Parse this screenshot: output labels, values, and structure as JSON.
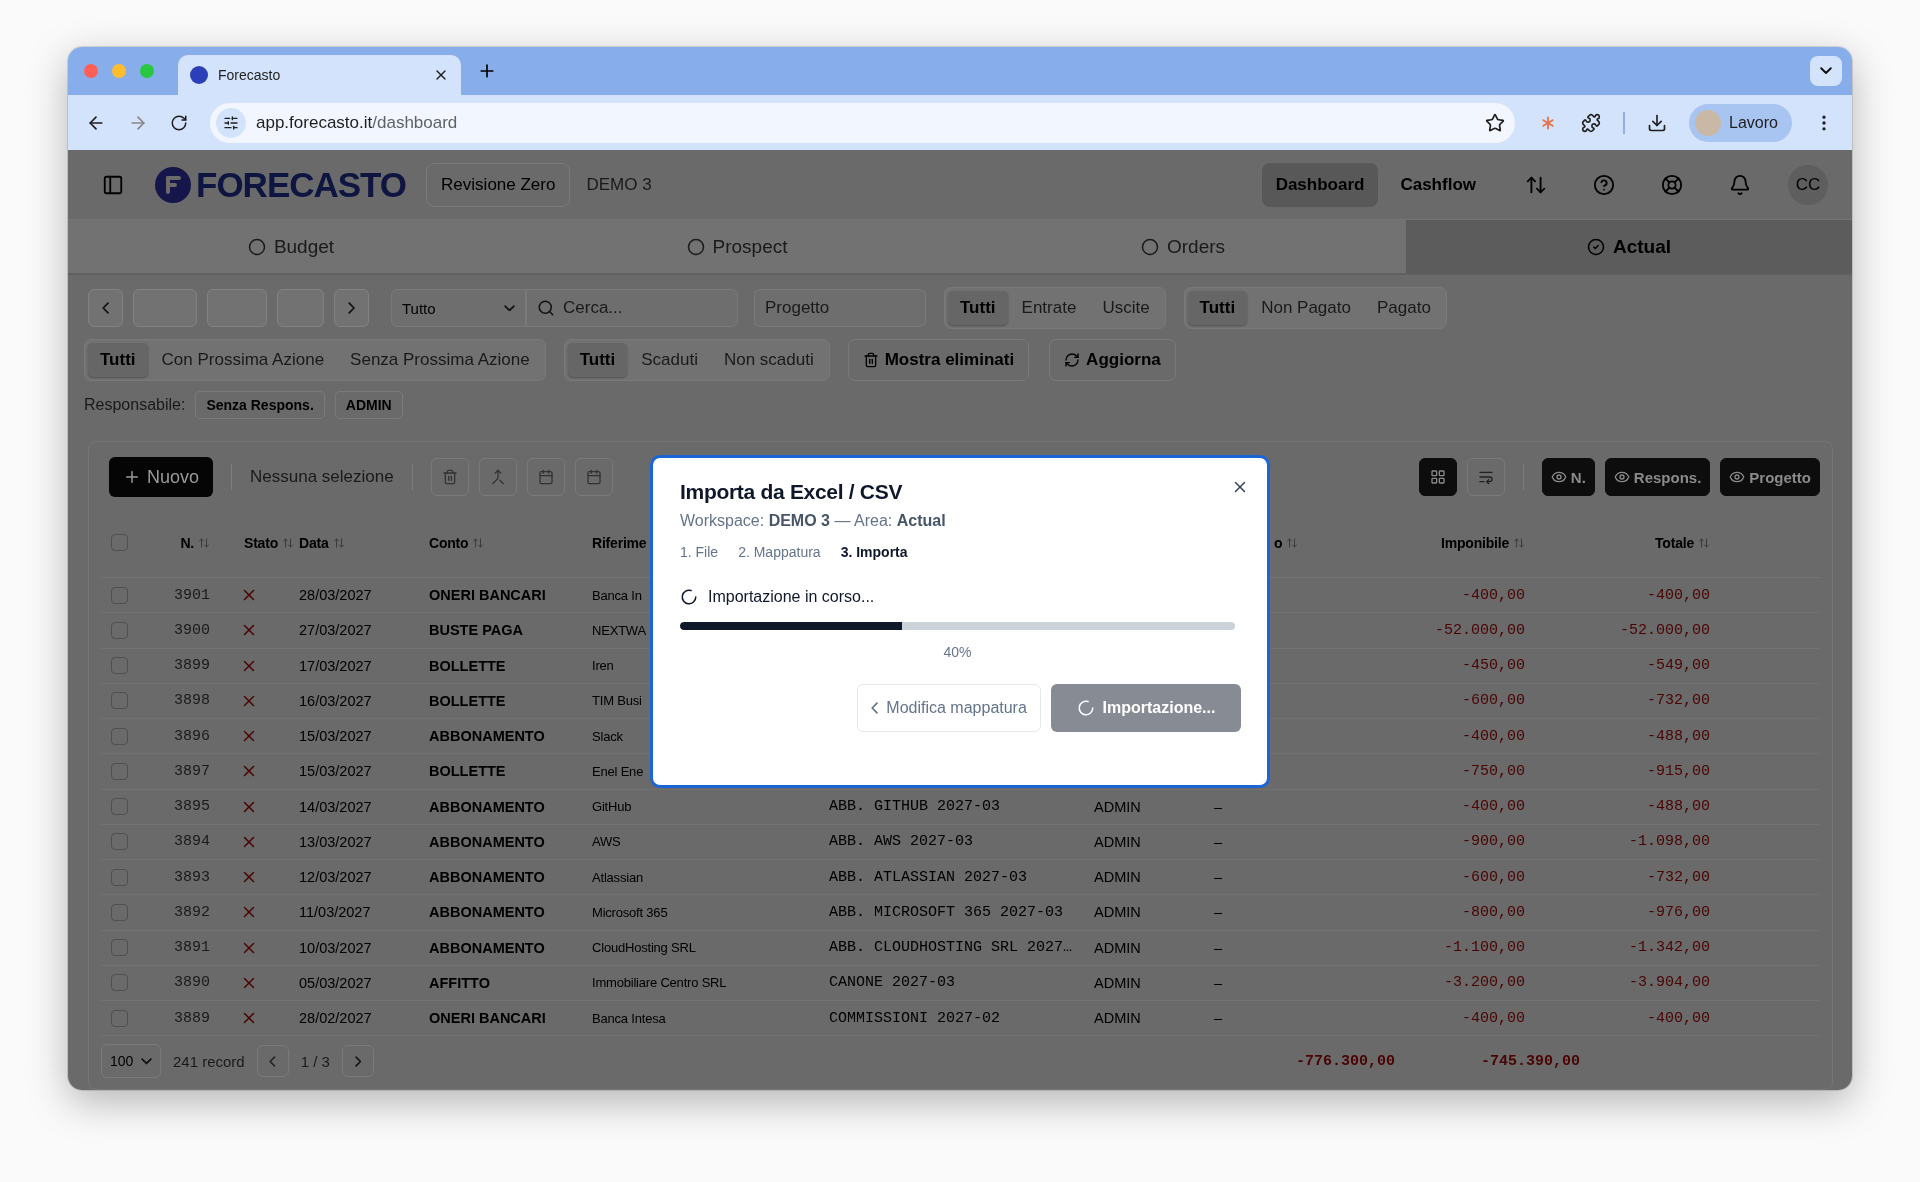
{
  "browser": {
    "tab_title": "Forecasto",
    "url_host": "app.forecasto.it",
    "url_path": "/dashboard",
    "profile": "Lavoro"
  },
  "header": {
    "logo": "FORECASTO",
    "revision": "Revisione Zero",
    "workspace": "DEMO 3",
    "avatar": "CC",
    "nav": [
      {
        "label": "Dashboard",
        "selected": true
      },
      {
        "label": "Cashflow",
        "selected": false
      }
    ]
  },
  "areas": [
    {
      "label": "Budget",
      "selected": false
    },
    {
      "label": "Prospect",
      "selected": false
    },
    {
      "label": "Orders",
      "selected": false
    },
    {
      "label": "Actual",
      "selected": true
    }
  ],
  "filters": {
    "type_select": "Tutto",
    "search_placeholder": "Cerca...",
    "project_placeholder": "Progetto",
    "flow": [
      {
        "label": "Tutti",
        "selected": true
      },
      {
        "label": "Entrate",
        "selected": false
      },
      {
        "label": "Uscite",
        "selected": false
      }
    ],
    "payment": [
      {
        "label": "Tutti",
        "selected": true
      },
      {
        "label": "Non Pagato",
        "selected": false
      },
      {
        "label": "Pagato",
        "selected": false
      }
    ],
    "action": [
      {
        "label": "Tutti",
        "selected": true
      },
      {
        "label": "Con Prossima Azione",
        "selected": false
      },
      {
        "label": "Senza Prossima Azione",
        "selected": false
      }
    ],
    "due": [
      {
        "label": "Tutti",
        "selected": true
      },
      {
        "label": "Scaduti",
        "selected": false
      },
      {
        "label": "Non scaduti",
        "selected": false
      }
    ],
    "show_deleted": "Mostra eliminati",
    "refresh": "Aggiorna",
    "owner_label": "Responsabile:",
    "owners": [
      "Senza Respons.",
      "ADMIN"
    ]
  },
  "toolbar": {
    "new": "Nuovo",
    "selection": "Nessuna selezione",
    "visible_columns": [
      "N.",
      "Respons.",
      "Progetto"
    ]
  },
  "table": {
    "select_all_checked": false,
    "columns": [
      "N.",
      "Stato",
      "Data",
      "Conto",
      "Riferime",
      "o",
      "Imponibile",
      "Totale"
    ],
    "rows": [
      {
        "checked": false,
        "n": "3901",
        "date": "28/03/2027",
        "account": "ONERI BANCARI",
        "reference": "Banca In",
        "imponibile": "-400,00",
        "totale": "-400,00"
      },
      {
        "checked": false,
        "n": "3900",
        "date": "27/03/2027",
        "account": "BUSTE PAGA",
        "reference": "NEXTWA",
        "imponibile": "-52.000,00",
        "totale": "-52.000,00"
      },
      {
        "checked": false,
        "n": "3899",
        "date": "17/03/2027",
        "account": "BOLLETTE",
        "reference": "Iren",
        "imponibile": "-450,00",
        "totale": "-549,00"
      },
      {
        "checked": false,
        "n": "3898",
        "date": "16/03/2027",
        "account": "BOLLETTE",
        "reference": "TIM Busi",
        "imponibile": "-600,00",
        "totale": "-732,00"
      },
      {
        "checked": false,
        "n": "3896",
        "date": "15/03/2027",
        "account": "ABBONAMENTO",
        "reference": "Slack",
        "imponibile": "-400,00",
        "totale": "-488,00"
      },
      {
        "checked": false,
        "n": "3897",
        "date": "15/03/2027",
        "account": "BOLLETTE",
        "reference": "Enel Ene",
        "imponibile": "-750,00",
        "totale": "-915,00"
      },
      {
        "checked": false,
        "n": "3895",
        "date": "14/03/2027",
        "account": "ABBONAMENTO",
        "reference": "GitHub",
        "code": "ABB. GITHUB 2027-03",
        "owner": "ADMIN",
        "project": "–",
        "imponibile": "-400,00",
        "totale": "-488,00"
      },
      {
        "checked": false,
        "n": "3894",
        "date": "13/03/2027",
        "account": "ABBONAMENTO",
        "reference": "AWS",
        "code": "ABB. AWS 2027-03",
        "owner": "ADMIN",
        "project": "–",
        "imponibile": "-900,00",
        "totale": "-1.098,00"
      },
      {
        "checked": false,
        "n": "3893",
        "date": "12/03/2027",
        "account": "ABBONAMENTO",
        "reference": "Atlassian",
        "code": "ABB. ATLASSIAN 2027-03",
        "owner": "ADMIN",
        "project": "–",
        "imponibile": "-600,00",
        "totale": "-732,00"
      },
      {
        "checked": false,
        "n": "3892",
        "date": "11/03/2027",
        "account": "ABBONAMENTO",
        "reference": "Microsoft 365",
        "code": "ABB. MICROSOFT 365 2027-03",
        "owner": "ADMIN",
        "project": "–",
        "imponibile": "-800,00",
        "totale": "-976,00"
      },
      {
        "checked": false,
        "n": "3891",
        "date": "10/03/2027",
        "account": "ABBONAMENTO",
        "reference": "CloudHosting SRL",
        "code": "ABB. CLOUDHOSTING SRL 2027…",
        "owner": "ADMIN",
        "project": "–",
        "imponibile": "-1.100,00",
        "totale": "-1.342,00"
      },
      {
        "checked": false,
        "n": "3890",
        "date": "05/03/2027",
        "account": "AFFITTO",
        "reference": "Immobiliare Centro SRL",
        "code": "CANONE 2027-03",
        "owner": "ADMIN",
        "project": "–",
        "imponibile": "-3.200,00",
        "totale": "-3.904,00"
      },
      {
        "checked": false,
        "n": "3889",
        "date": "28/02/2027",
        "account": "ONERI BANCARI",
        "reference": "Banca Intesa",
        "code": "COMMISSIONI 2027-02",
        "owner": "ADMIN",
        "project": "–",
        "imponibile": "-400,00",
        "totale": "-400,00"
      }
    ]
  },
  "footer": {
    "page_size": "100",
    "count": "241 record",
    "page": "1 / 3",
    "total_imponibile": "-776.300,00",
    "total_totale": "-745.390,00"
  },
  "modal": {
    "title": "Importa da Excel / CSV",
    "subtitle": "Workspace: **DEMO 3** — Area: **Actual**",
    "steps": [
      {
        "label": "1. File",
        "selected": false
      },
      {
        "label": "2. Mappatura",
        "selected": false
      },
      {
        "label": "3. Importa",
        "selected": true
      }
    ],
    "status": "Importazione in corso...",
    "level": 0.4,
    "percent": "40%",
    "back": "Modifica mappatura",
    "submit": {
      "label": "Importazione...",
      "disabled": true
    }
  }
}
